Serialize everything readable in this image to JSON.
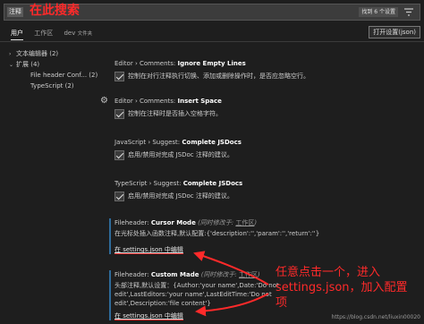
{
  "search": {
    "query": "注释",
    "annotation": "在此搜索",
    "found": "找到 6 个设置",
    "filter_icon": "filter-icon"
  },
  "tabs": [
    {
      "label": "用户",
      "sub": ""
    },
    {
      "label": "工作区",
      "sub": ""
    },
    {
      "label": "dev",
      "sub": "文件夹"
    }
  ],
  "open_json_label": "打开设置(json)",
  "tree": [
    {
      "label": "文本编辑器 (2)",
      "chevron": "›"
    },
    {
      "label": "扩展 (4)",
      "chevron": "⌄"
    },
    {
      "label": "File header Conf... (2)",
      "chevron": ""
    },
    {
      "label": "TypeScript (2)",
      "chevron": ""
    }
  ],
  "settings": [
    {
      "category": "Editor › Comments: ",
      "name": "Ignore Empty Lines",
      "desc": "控制在对行注释执行切换、添加或删除操作时，是否应忽略空行。"
    },
    {
      "category": "Editor › Comments: ",
      "name": "Insert Space",
      "desc": "控制在注释时是否插入空格字符。"
    },
    {
      "category": "JavaScript › Suggest: ",
      "name": "Complete JSDocs",
      "desc": "启用/禁用对完成 JSDoc 注释的建议。"
    },
    {
      "category": "TypeScript › Suggest: ",
      "name": "Complete JSDocs",
      "desc": "启用/禁用对完成 JSDoc 注释的建议。"
    }
  ],
  "ext_settings": [
    {
      "category": "Fileheader: ",
      "name": "Cursor Mode",
      "modified": "(同时修改于: ",
      "modified_link": "工作区",
      "modified_end": ")",
      "desc": "在光标处插入函数注释,默认配置:{'description':'','param':'','return':''}",
      "edit": "在 settings.json 中编辑"
    },
    {
      "category": "Fileheader: ",
      "name": "Custom Made",
      "modified": "(同时修改于: ",
      "modified_link": "工作区",
      "modified_end": ")",
      "desc": "头部注释,默认设置：{Author:'your name',Date:'Do not edit',LastEditors:'your name',LastEditTime:'Do not edit',Description:'file content'}",
      "edit": "在 settings.json 中编辑"
    }
  ],
  "annotation_text": "任意点击一个，进入settings.json，加入配置项",
  "watermark": "https://blog.csdn.net/liuxin00020",
  "colors": {
    "annotation": "#ff2a2a",
    "background": "#1e1e1e",
    "ext_border": "#2f6b9a"
  }
}
